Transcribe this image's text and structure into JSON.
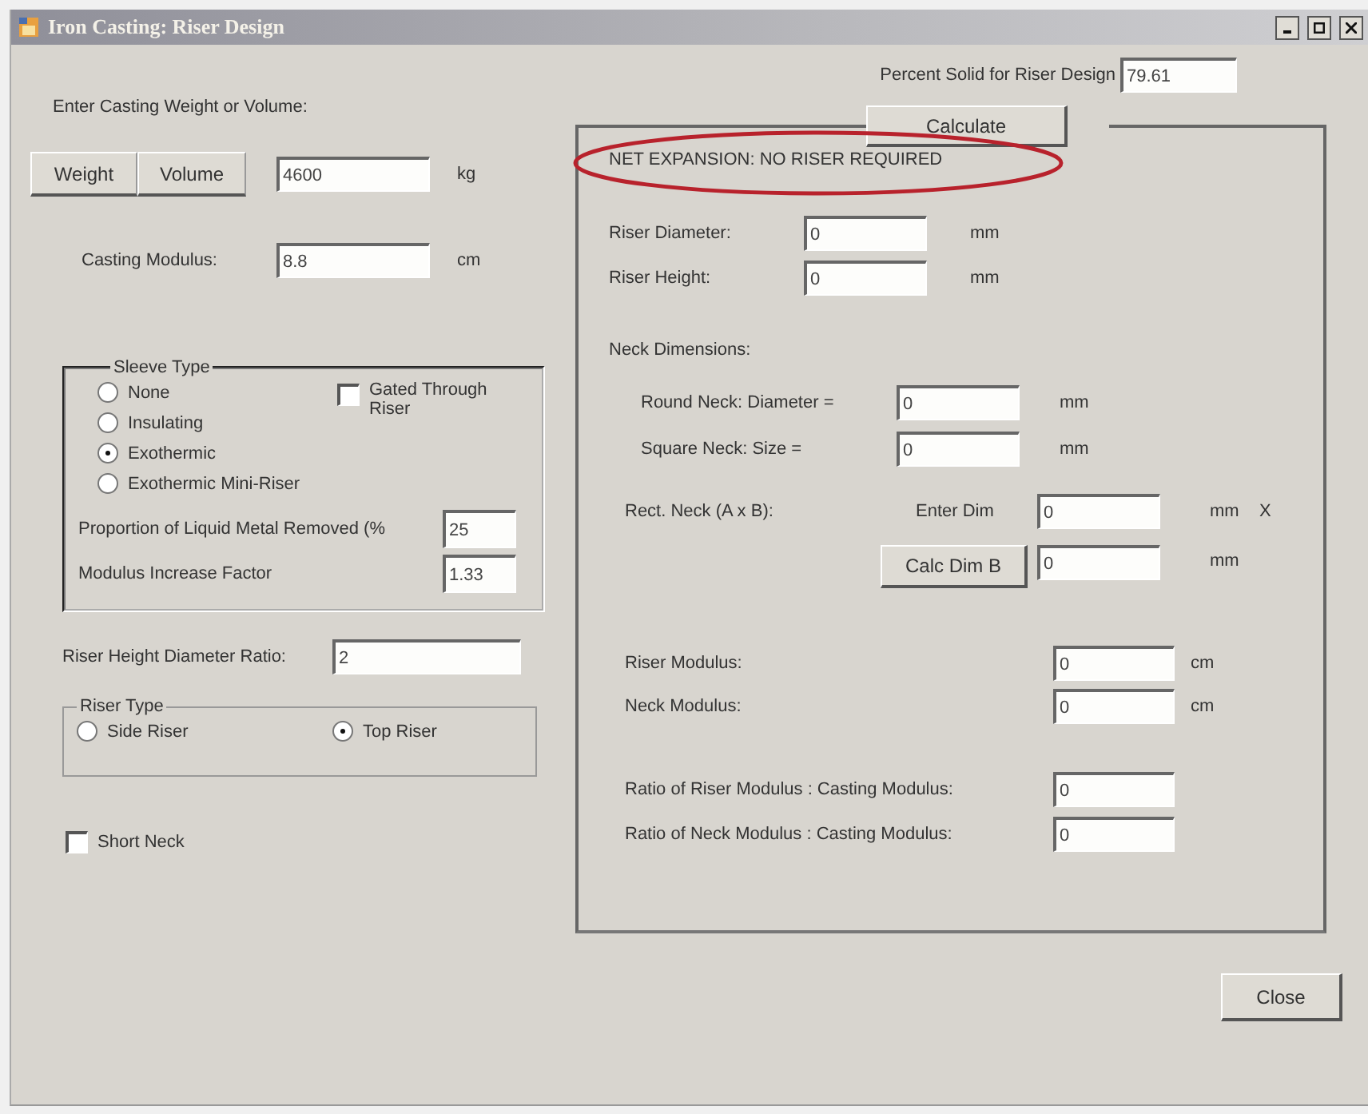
{
  "window": {
    "title": "Iron Casting: Riser Design"
  },
  "left": {
    "prompt": "Enter Casting Weight or Volume:",
    "mode_buttons": [
      {
        "label": "Weight"
      },
      {
        "label": "Volume"
      }
    ],
    "amount": {
      "value": "4600",
      "unit": "kg"
    },
    "casting_modulus": {
      "label": "Casting Modulus:",
      "value": "8.8",
      "unit": "cm"
    },
    "sleeve_type": {
      "title": "Sleeve Type",
      "options": [
        {
          "label": "None",
          "selected": false
        },
        {
          "label": "Insulating",
          "selected": false
        },
        {
          "label": "Exothermic",
          "selected": true
        },
        {
          "label": "Exothermic Mini-Riser",
          "selected": false
        }
      ],
      "gated_through_riser": {
        "label": "Gated Through Riser",
        "checked": false
      },
      "fields": [
        {
          "label": "Proportion of Liquid Metal Removed (%",
          "value": "25"
        },
        {
          "label": "Modulus Increase Factor",
          "value": "1.33"
        }
      ]
    },
    "height_diameter_ratio": {
      "label": "Riser Height Diameter Ratio:",
      "value": "2"
    },
    "riser_type": {
      "title": "Riser Type",
      "options": [
        {
          "label": "Side Riser",
          "selected": false
        },
        {
          "label": "Top Riser",
          "selected": true
        }
      ]
    },
    "short_neck": {
      "label": "Short Neck",
      "checked": false
    }
  },
  "right": {
    "percent_solid": {
      "label": "Percent Solid for Riser Design",
      "value": "79.61"
    },
    "calculate_button": "Calculate",
    "message": "NET EXPANSION: NO RISER REQUIRED",
    "riser_fields": [
      {
        "label": "Riser Diameter:",
        "value": "0",
        "unit": "mm"
      },
      {
        "label": "Riser Height:",
        "value": "0",
        "unit": "mm"
      }
    ],
    "neck_title": "Neck Dimensions:",
    "neck_fields": [
      {
        "label": "Round Neck:  Diameter =",
        "value": "0",
        "unit": "mm"
      },
      {
        "label": "Square Neck:  Size =",
        "value": "0",
        "unit": "mm"
      }
    ],
    "rect_neck": {
      "label": "Rect. Neck (A x B):",
      "enter_label": "Enter Dim",
      "value_a": "0",
      "unit_a": "mm",
      "times": "X",
      "calc_button": "Calc Dim B",
      "value_b": "0",
      "unit_b": "mm"
    },
    "modulus_fields": [
      {
        "label": "Riser Modulus:",
        "value": "0",
        "unit": "cm"
      },
      {
        "label": "Neck Modulus:",
        "value": "0",
        "unit": "cm"
      }
    ],
    "ratio_fields": [
      {
        "label": "Ratio of Riser Modulus : Casting Modulus:",
        "value": "0"
      },
      {
        "label": "Ratio of Neck Modulus : Casting Modulus:",
        "value": "0"
      }
    ]
  },
  "close_button": "Close"
}
